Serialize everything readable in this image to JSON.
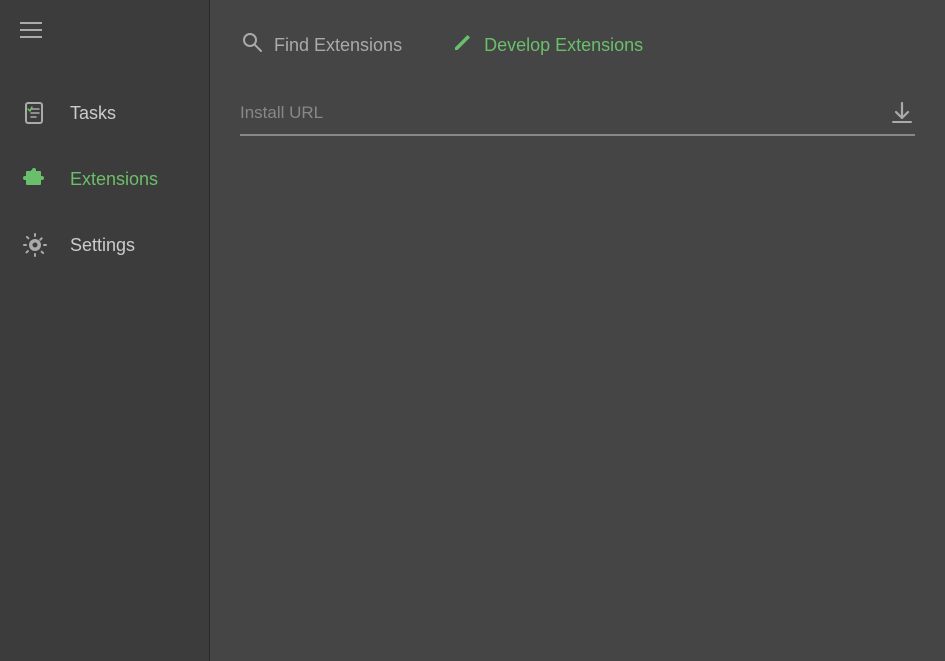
{
  "sidebar": {
    "items": [
      {
        "id": "tasks",
        "label": "Tasks",
        "icon": "tasks-icon",
        "active": false
      },
      {
        "id": "extensions",
        "label": "Extensions",
        "icon": "puzzle-icon",
        "active": true
      },
      {
        "id": "settings",
        "label": "Settings",
        "icon": "gear-icon",
        "active": false
      }
    ]
  },
  "topbar": {
    "tabs": [
      {
        "id": "find-extensions",
        "label": "Find Extensions",
        "icon": "search",
        "active": false
      },
      {
        "id": "develop-extensions",
        "label": "Develop Extensions",
        "icon": "pencil",
        "active": true
      }
    ]
  },
  "content": {
    "url_placeholder": "Install URL",
    "download_label": "⬇"
  },
  "colors": {
    "accent": "#6abf6a",
    "sidebar_bg": "#3c3c3c",
    "main_bg": "#454545",
    "text_primary": "#ccc",
    "text_muted": "#888"
  }
}
